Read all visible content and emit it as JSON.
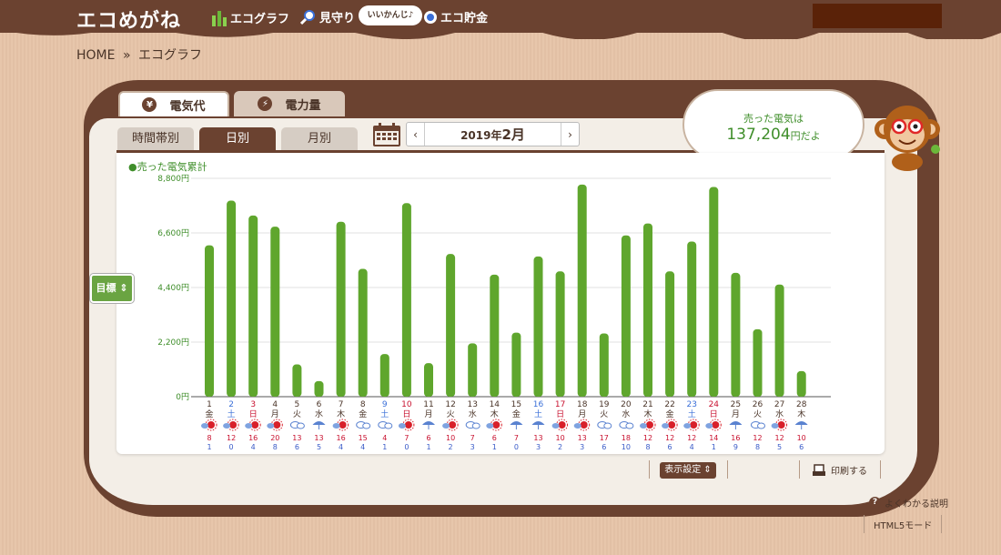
{
  "header": {
    "logo": "エコめがね",
    "nav": [
      {
        "label": "エコグラフ",
        "icon": "bar-chart-icon"
      },
      {
        "label": "見守り",
        "icon": "magnifier-icon"
      },
      {
        "label": "エコ貯金",
        "icon": "coin-icon"
      }
    ],
    "bubble": "いいかんじ♪"
  },
  "breadcrumb": {
    "home": "HOME",
    "sep": "»",
    "current": "エコグラフ"
  },
  "tabs": {
    "top": [
      {
        "label": "電気代",
        "icon": "yen-icon",
        "active": true
      },
      {
        "label": "電力量",
        "icon": "lightning-icon",
        "active": false
      }
    ],
    "sub": [
      {
        "label": "時間帯別",
        "active": false
      },
      {
        "label": "日別",
        "active": true
      },
      {
        "label": "月別",
        "active": false
      }
    ]
  },
  "date_nav": {
    "prev": "‹",
    "year": "2019年",
    "month": "2月",
    "next": "›"
  },
  "summary": {
    "line1": "売った電気は",
    "amount": "137,204",
    "suffix": "円だよ"
  },
  "legend": "●売った電気累計",
  "goal_button": "目標 ⇕",
  "controls": {
    "display_settings": "表示設定 ⇕",
    "print": "印刷する"
  },
  "footer": {
    "help": "よくわかる説明",
    "html5": "HTML5モード"
  },
  "colors": {
    "bar": "#5fa62d",
    "brown": "#6b4230",
    "sat": "#3a6fd8",
    "sun": "#c8102e",
    "high": "#c8102e",
    "low": "#3a5bc8"
  },
  "chart_data": {
    "type": "bar",
    "yticks": [
      "0円",
      "2,200円",
      "4,400円",
      "6,600円",
      "8,800円"
    ],
    "ylim": [
      0,
      8800
    ],
    "days": [
      "1",
      "2",
      "3",
      "4",
      "5",
      "6",
      "7",
      "8",
      "9",
      "10",
      "11",
      "12",
      "13",
      "14",
      "15",
      "16",
      "17",
      "18",
      "19",
      "20",
      "21",
      "22",
      "23",
      "24",
      "25",
      "26",
      "27",
      "28"
    ],
    "weekdays": [
      "金",
      "土",
      "日",
      "月",
      "火",
      "水",
      "木",
      "金",
      "土",
      "日",
      "月",
      "火",
      "水",
      "木",
      "金",
      "土",
      "日",
      "月",
      "火",
      "水",
      "木",
      "金",
      "土",
      "日",
      "月",
      "火",
      "水",
      "木"
    ],
    "values": [
      6100,
      7900,
      7300,
      6850,
      1300,
      630,
      7050,
      5150,
      1720,
      7800,
      1350,
      5750,
      2150,
      4920,
      2580,
      5650,
      5050,
      8550,
      2550,
      6500,
      6980,
      5050,
      6250,
      8450,
      4990,
      2720,
      4520,
      1030
    ],
    "weather": [
      "sun",
      "sun",
      "sun",
      "sun",
      "cloud",
      "umbrella",
      "sun-cloud",
      "cloud-cloud",
      "cloud-cloud",
      "sun-cloud",
      "umbrella-cloud",
      "sun",
      "cloud-cloud",
      "sun",
      "umbrella",
      "umbrella",
      "sun",
      "sun",
      "cloud",
      "cloud",
      "sun",
      "sun",
      "sun",
      "sun",
      "umbrella",
      "cloud-cloud",
      "sun",
      "umbrella"
    ],
    "high": [
      "8",
      "12",
      "16",
      "20",
      "13",
      "13",
      "16",
      "15",
      "4",
      "7",
      "6",
      "10",
      "7",
      "6",
      "7",
      "13",
      "10",
      "13",
      "17",
      "18",
      "12",
      "12",
      "12",
      "14",
      "16",
      "12",
      "12",
      "10"
    ],
    "low": [
      "1",
      "0",
      "4",
      "8",
      "6",
      "5",
      "4",
      "4",
      "1",
      "0",
      "1",
      "2",
      "3",
      "1",
      "0",
      "3",
      "2",
      "3",
      "6",
      "10",
      "8",
      "6",
      "4",
      "1",
      "9",
      "8",
      "5",
      "6"
    ]
  }
}
